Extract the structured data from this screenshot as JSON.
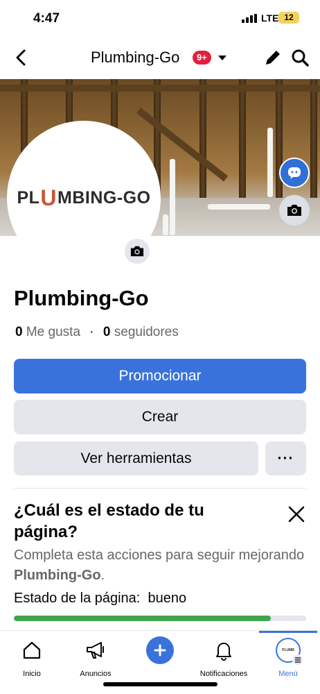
{
  "status_bar": {
    "time": "4:47",
    "network": "LTE",
    "battery": "12"
  },
  "nav": {
    "title": "Plumbing-Go",
    "notifications_badge": "9+"
  },
  "profile": {
    "logo_left": "PL",
    "logo_u": "U",
    "logo_right": "MBING-GO",
    "name": "Plumbing-Go",
    "likes_count": "0",
    "likes_label": "Me gusta",
    "separator": "·",
    "followers_count": "0",
    "followers_label": "seguidores"
  },
  "actions": {
    "promote": "Promocionar",
    "create": "Crear",
    "tools": "Ver herramientas",
    "more": "···"
  },
  "status_card": {
    "title": "¿Cuál es el estado de tu página?",
    "desc_prefix": "Completa esta acciones para seguir mejorando ",
    "desc_page": "Plumbing-Go",
    "desc_suffix": ".",
    "state_label": "Estado de la página:",
    "state_value": "bueno",
    "progress_fraction": 0.88
  },
  "tabs": [
    {
      "label": "Inicio",
      "icon": "home-icon"
    },
    {
      "label": "Anuncios",
      "icon": "megaphone-icon"
    },
    {
      "label": "",
      "icon": "plus-icon"
    },
    {
      "label": "Notificaciones",
      "icon": "bell-icon"
    },
    {
      "label": "Menú",
      "icon": "menu-avatar-icon",
      "active": true
    }
  ],
  "colors": {
    "accent": "#3a72db",
    "badge": "#e41e3f",
    "progress": "#42a44e",
    "logo_u": "#c8573a"
  }
}
